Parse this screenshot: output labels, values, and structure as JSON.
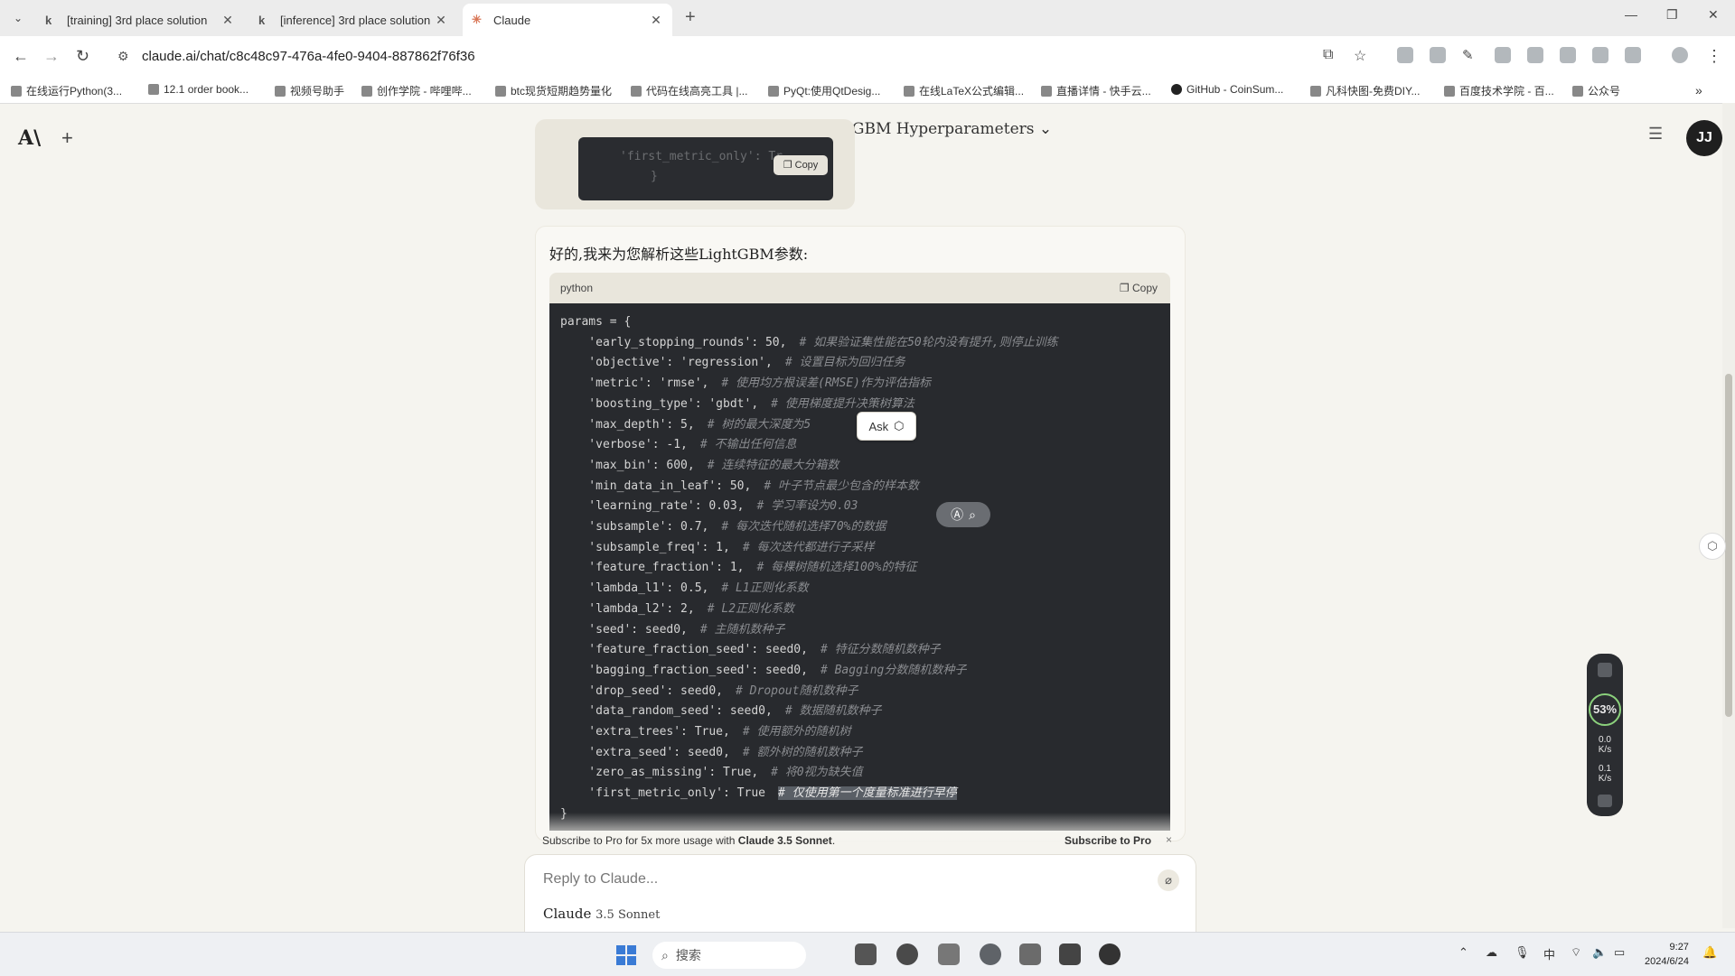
{
  "browser": {
    "tabs": [
      {
        "favicon": "k",
        "title": "[training] 3rd place solution",
        "active": false
      },
      {
        "favicon": "k",
        "title": "[inference] 3rd place solution",
        "active": false
      },
      {
        "favicon": "✳",
        "title": "Claude",
        "active": true
      }
    ],
    "url": "claude.ai/chat/c8c48c97-476a-4fe0-9404-887862f76f36",
    "bookmarks": [
      "在线运行Python(3...",
      "12.1 order book...",
      "视频号助手",
      "创作学院 - 哔哩哔...",
      "btc现货短期趋势量化",
      "代码在线高亮工具 |...",
      "PyQt:使用QtDesig...",
      "在线LaTeX公式编辑...",
      "直播详情 - 快手云...",
      "GitHub - CoinSum...",
      "凡科快图-免费DIY...",
      "百度技术学院 - 百...",
      "公众号"
    ]
  },
  "app": {
    "logo": "A\\",
    "conversation_title": "Explaining LightGBM Hyperparameters",
    "avatar_initials": "JJ"
  },
  "previous_message": {
    "code_line_1": "'first_metric_only': Tr",
    "code_line_2": "}",
    "copy_label": "Copy"
  },
  "assistant": {
    "intro": "好的,我来为您解析这些LightGBM参数:",
    "code_lang": "python",
    "copy_label": "Copy",
    "code_lines": [
      {
        "code": "params = {",
        "comment": ""
      },
      {
        "code": "    'early_stopping_rounds': 50,",
        "comment": "# 如果验证集性能在50轮内没有提升,则停止训练"
      },
      {
        "code": "    'objective': 'regression',",
        "comment": "# 设置目标为回归任务"
      },
      {
        "code": "    'metric': 'rmse',",
        "comment": "# 使用均方根误差(RMSE)作为评估指标"
      },
      {
        "code": "    'boosting_type': 'gbdt',",
        "comment": "# 使用梯度提升决策树算法"
      },
      {
        "code": "    'max_depth': 5,",
        "comment": "# 树的最大深度为5"
      },
      {
        "code": "    'verbose': -1,",
        "comment": "# 不输出任何信息"
      },
      {
        "code": "    'max_bin': 600,",
        "comment": "# 连续特征的最大分箱数"
      },
      {
        "code": "    'min_data_in_leaf': 50,",
        "comment": "# 叶子节点最少包含的样本数"
      },
      {
        "code": "    'learning_rate': 0.03,",
        "comment": "# 学习率设为0.03"
      },
      {
        "code": "    'subsample': 0.7,",
        "comment": "# 每次迭代随机选择70%的数据"
      },
      {
        "code": "    'subsample_freq': 1,",
        "comment": "# 每次迭代都进行子采样"
      },
      {
        "code": "    'feature_fraction': 1,",
        "comment": "# 每棵树随机选择100%的特征"
      },
      {
        "code": "    'lambda_l1': 0.5,",
        "comment": "# L1正则化系数"
      },
      {
        "code": "    'lambda_l2': 2,",
        "comment": "# L2正则化系数"
      },
      {
        "code": "    'seed': seed0,",
        "comment": "# 主随机数种子"
      },
      {
        "code": "    'feature_fraction_seed': seed0,",
        "comment": "# 特征分数随机数种子"
      },
      {
        "code": "    'bagging_fraction_seed': seed0,",
        "comment": "# Bagging分数随机数种子"
      },
      {
        "code": "    'drop_seed': seed0,",
        "comment": "# Dropout随机数种子"
      },
      {
        "code": "    'data_random_seed': seed0,",
        "comment": "# 数据随机数种子"
      },
      {
        "code": "    'extra_trees': True,",
        "comment": "# 使用额外的随机树"
      },
      {
        "code": "    'extra_seed': seed0,",
        "comment": "# 额外树的随机数种子"
      },
      {
        "code": "    'zero_as_missing': True,",
        "comment": "# 将0视为缺失值"
      },
      {
        "code": "    'first_metric_only': True",
        "comment": "# 仅使用第一个度量标准进行早停"
      },
      {
        "code": "}",
        "comment": ""
      }
    ],
    "ask_popup": "Ask"
  },
  "banner": {
    "text_prefix": "Subscribe to Pro for 5x more usage with ",
    "text_model": "Claude 3.5 Sonnet",
    "text_suffix": ".",
    "action": "Subscribe to Pro",
    "close": "×"
  },
  "composer": {
    "placeholder": "Reply to Claude...",
    "model_name": "Claude",
    "model_version": "3.5 Sonnet"
  },
  "net_widget": {
    "percent": "53%",
    "down": "0.0",
    "down_unit": "K/s",
    "up": "0.1",
    "up_unit": "K/s"
  },
  "taskbar": {
    "search_placeholder": "搜索",
    "ime": "中",
    "time": "9:27",
    "date": "2024/6/24"
  }
}
